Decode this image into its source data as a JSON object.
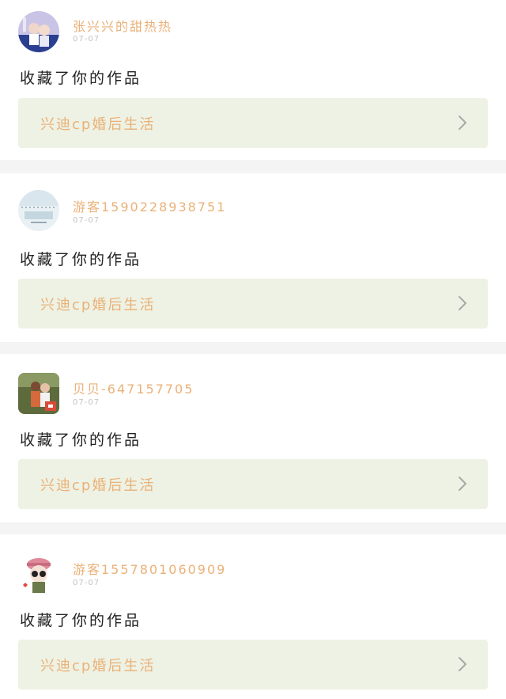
{
  "items": [
    {
      "username": "张兴兴的甜热热",
      "date": "07-07",
      "action": "收藏了你的作品",
      "work_title": "兴迪cp婚后生活",
      "avatar_icon": "avatar-couple-photo"
    },
    {
      "username": "游客15902289387​51",
      "date": "07-07",
      "action": "收藏了你的作品",
      "work_title": "兴迪cp婚后生活",
      "avatar_icon": "avatar-light-blue-photo"
    },
    {
      "username": "贝贝-647157705",
      "date": "07-07",
      "action": "收藏了你的作品",
      "work_title": "兴迪cp婚后生活",
      "avatar_icon": "avatar-two-people-photo"
    },
    {
      "username": "游客1557801060909",
      "date": "07-07",
      "action": "收藏了你的作品",
      "work_title": "兴迪cp婚后生活",
      "avatar_icon": "avatar-cartoon-girl"
    }
  ],
  "colors": {
    "accent": "#eab178",
    "card_bg": "#ffffff",
    "box_bg": "#eef2e4",
    "divider": "#f4f4f4"
  }
}
